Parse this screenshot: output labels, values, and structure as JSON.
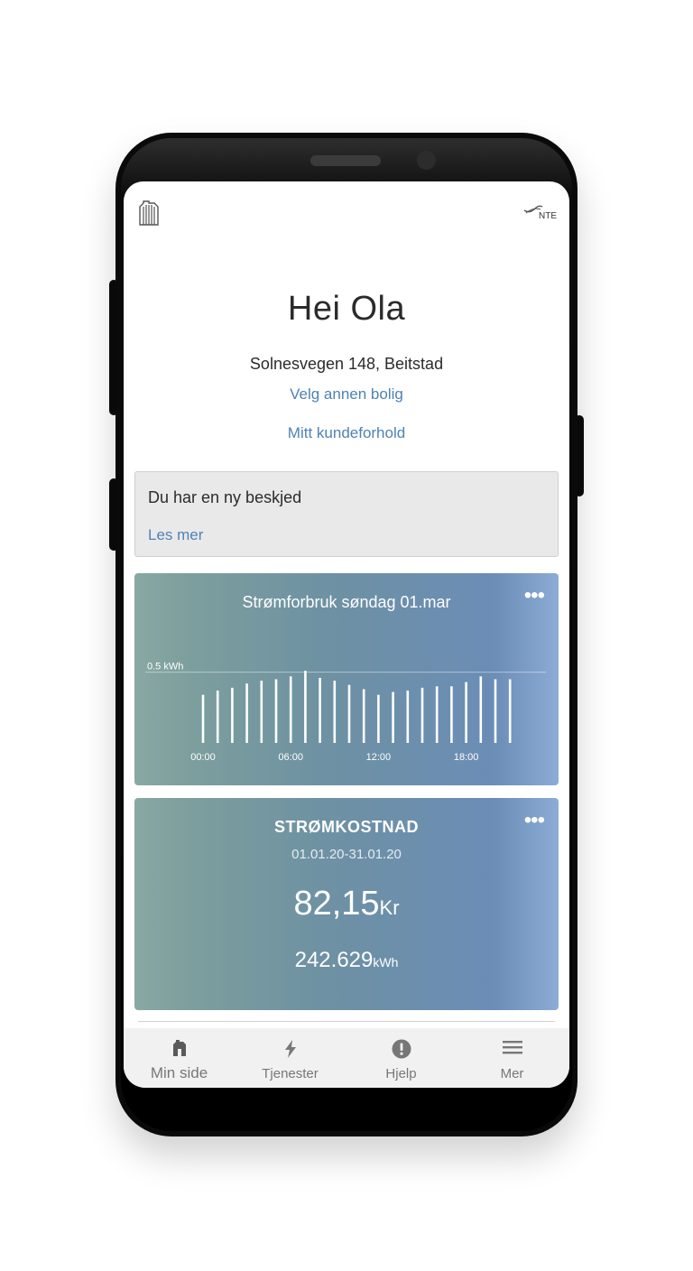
{
  "header": {
    "greeting": "Hei Ola",
    "address": "Solnesvegen 148, Beitstad",
    "change_home_link": "Velg annen bolig",
    "customer_link": "Mitt kundeforhold",
    "brand_logo_text": "NTE"
  },
  "message": {
    "title": "Du har en ny beskjed",
    "link": "Les mer"
  },
  "usage_card": {
    "title": "Strømforbruk søndag 01.mar",
    "more_icon": "•••"
  },
  "cost_card": {
    "title": "STRØMKOSTNAD",
    "range": "01.01.20-31.01.20",
    "amount": "82,15",
    "amount_unit": "Kr",
    "energy": "242.629",
    "energy_unit": "kWh",
    "more_icon": "•••"
  },
  "nav": {
    "items": [
      {
        "label": "Min side",
        "icon": "home-icon"
      },
      {
        "label": "Tjenester",
        "icon": "lightning-icon"
      },
      {
        "label": "Hjelp",
        "icon": "alert-icon"
      },
      {
        "label": "Mer",
        "icon": "menu-icon"
      }
    ]
  },
  "chart_data": {
    "type": "bar",
    "title": "Strømforbruk søndag 01.mar",
    "ref_label": "0.5 kWh",
    "ref_value": 0.5,
    "ylim": [
      0,
      0.74
    ],
    "x_tick_labels": [
      "00:00",
      "06:00",
      "12:00",
      "18:00"
    ],
    "categories": [
      "00",
      "01",
      "02",
      "03",
      "04",
      "05",
      "06",
      "07",
      "08",
      "09",
      "10",
      "11",
      "12",
      "13",
      "14",
      "15",
      "16",
      "17",
      "18",
      "19",
      "20",
      "21"
    ],
    "values": [
      0.34,
      0.37,
      0.39,
      0.42,
      0.44,
      0.45,
      0.47,
      0.51,
      0.46,
      0.44,
      0.41,
      0.38,
      0.34,
      0.36,
      0.37,
      0.39,
      0.4,
      0.4,
      0.43,
      0.47,
      0.45,
      0.45
    ],
    "bar_color": "#ffffff",
    "grid": false
  },
  "colors": {
    "link": "#4f82b3",
    "card_gradient_start": "#8aa8a4",
    "card_gradient_end": "#8cacd6"
  }
}
